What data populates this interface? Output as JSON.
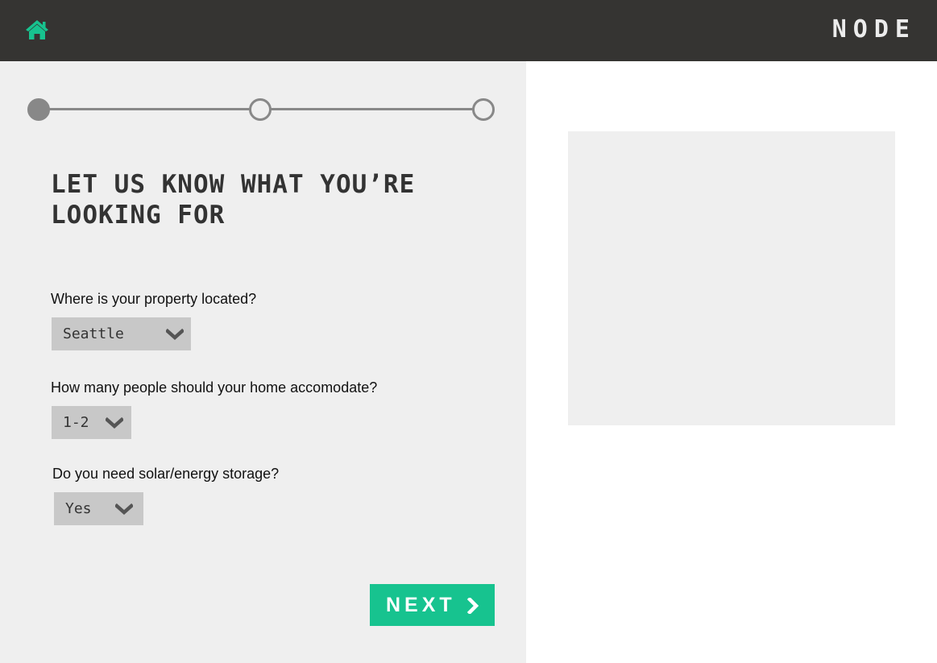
{
  "header": {
    "brand": "NODE",
    "home_icon": "home-icon"
  },
  "colors": {
    "topbar": "#353432",
    "accent": "#17c38f",
    "panel": "#efefef",
    "select_bg": "#c8c8c8",
    "stepper": "#888888"
  },
  "stepper": {
    "steps": 3,
    "current": 1
  },
  "form": {
    "heading": "LET US KNOW WHAT YOU’RE\nLOOKING FOR",
    "location": {
      "question": "Where is your property located?",
      "value": "Seattle"
    },
    "people": {
      "question": "How many people should your home accomodate?",
      "value": "1-2"
    },
    "solar": {
      "question": "Do you need solar/energy storage?",
      "value": "Yes"
    },
    "next_label": "NEXT"
  }
}
